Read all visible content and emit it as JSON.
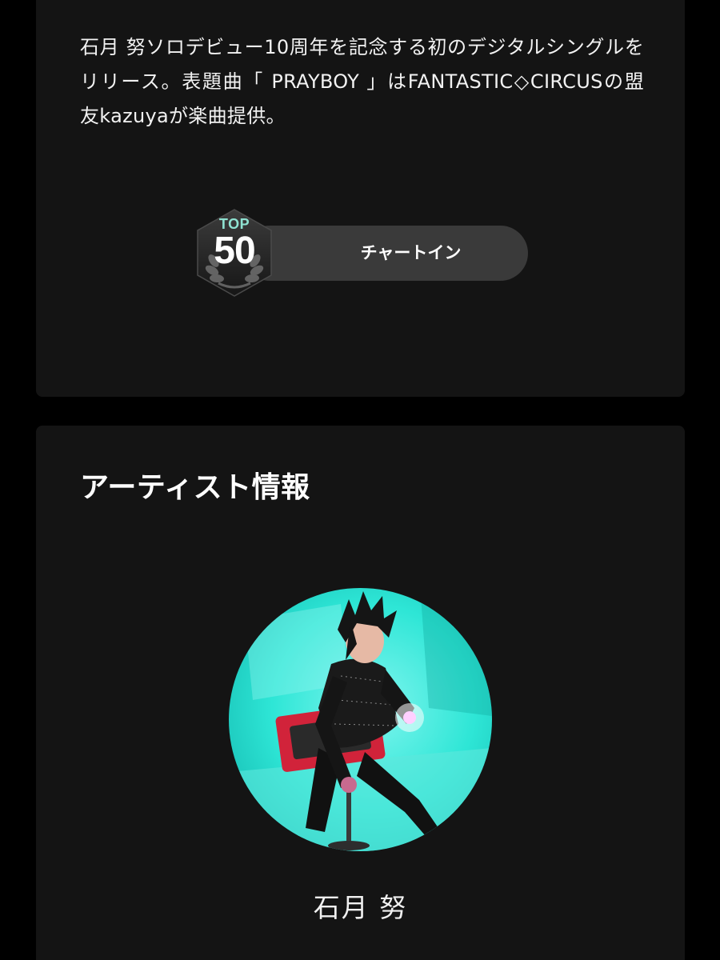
{
  "release": {
    "description": "石月 努ソロデビュー10周年を記念する初のデジタルシングルをリリース。表題曲「 PRAYBOY 」はFANTASTIC◇CIRCUSの盟友kazuyaが楽曲提供。",
    "chart_badge": {
      "top_label": "TOP",
      "rank": "50",
      "label": "チャートイン"
    }
  },
  "artist_section": {
    "title": "アーティスト情報",
    "artist_name": "石月 努"
  },
  "colors": {
    "background": "#000000",
    "card": "#141414",
    "pill": "#3a3a3a",
    "badge_accent": "#8fe3d2",
    "avatar_bg": "#2ee6d6"
  },
  "icons": {
    "rank_badge": "laurel-hexagon-icon"
  }
}
